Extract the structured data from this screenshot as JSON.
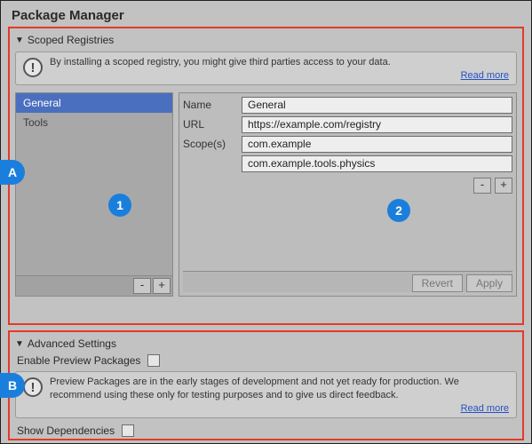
{
  "window_title": "Package Manager",
  "scoped": {
    "header": "Scoped Registries",
    "info_text": "By installing a scoped registry, you might give third parties access to your data.",
    "read_more": "Read more",
    "list": [
      "General",
      "Tools"
    ],
    "selected_index": 0,
    "minus": "-",
    "plus": "+",
    "form": {
      "name_label": "Name",
      "name_value": "General",
      "url_label": "URL",
      "url_value": "https://example.com/registry",
      "scope_label": "Scope(s)",
      "scope1": "com.example",
      "scope2": "com.example.tools.physics"
    },
    "revert": "Revert",
    "apply": "Apply"
  },
  "advanced": {
    "header": "Advanced Settings",
    "enable_preview_label": "Enable Preview Packages",
    "preview_info": "Preview Packages are in the early stages of development and not yet ready for production. We recommend using these only for testing purposes and to give us direct feedback.",
    "read_more": "Read more",
    "show_deps_label": "Show Dependencies"
  },
  "markers": {
    "A": "A",
    "B": "B",
    "one": "1",
    "two": "2"
  }
}
